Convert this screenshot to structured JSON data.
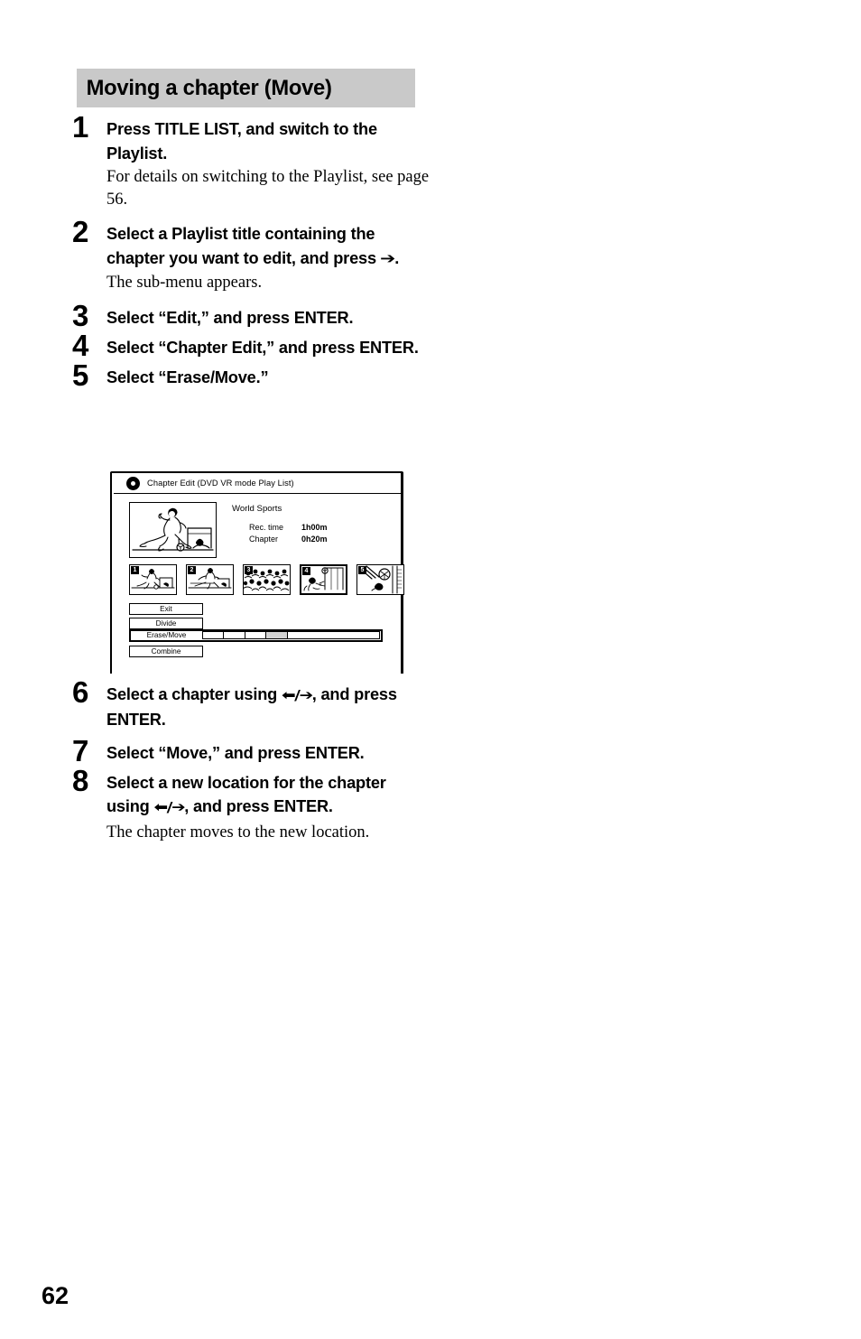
{
  "page": {
    "number": "62"
  },
  "section": {
    "heading": "Moving a chapter (Move)"
  },
  "steps": [
    {
      "number": "1",
      "title": "Press TITLE LIST, and switch to the Playlist.",
      "note": "For details on switching to the Playlist, see page 56."
    },
    {
      "number": "2",
      "title_before_arrow": "Select a Playlist title containing the chapter you want to edit, and press ",
      "arrow": "➔",
      "title_after_arrow": ".",
      "note": "The sub-menu appears."
    },
    {
      "number": "3",
      "title": "Select “Edit,” and press ENTER.",
      "note": ""
    },
    {
      "number": "4",
      "title": "Select “Chapter Edit,” and press ENTER.",
      "note": ""
    },
    {
      "number": "5",
      "title": "Select “Erase/Move.”",
      "note": ""
    },
    {
      "number": "6",
      "title_before_arrow": "Select a chapter using ",
      "arrow": "⬅/➔",
      "title_after_arrow": ", and press ENTER.",
      "note": ""
    },
    {
      "number": "7",
      "title": "Select “Move,” and press ENTER.",
      "note": ""
    },
    {
      "number": "8",
      "title_before_arrow": "Select a new location for the chapter using ",
      "arrow": "⬅/➔",
      "title_after_arrow": ", and press ENTER.",
      "note": "The chapter moves to the new location."
    }
  ],
  "screen": {
    "title_bar": {
      "icon": "disc-icon",
      "text": "Chapter Edit (DVD VR mode Play List)"
    },
    "title": "World Sports",
    "info": [
      {
        "label": "Rec. time",
        "value": "1h00m"
      },
      {
        "label": "Chapter",
        "value": "0h20m"
      }
    ],
    "chapters": [
      {
        "number": "1",
        "selected": false
      },
      {
        "number": "2",
        "selected": false
      },
      {
        "number": "3",
        "selected": false
      },
      {
        "number": "4",
        "selected": true
      },
      {
        "number": "5",
        "selected": false
      }
    ],
    "menu": [
      {
        "label": "Exit",
        "active": false
      },
      {
        "label": "Divide",
        "active": false
      },
      {
        "label": "Erase/Move",
        "active": true
      },
      {
        "label": "Combine",
        "active": false
      }
    ],
    "progress": {
      "segment_widths": [
        12,
        12,
        12,
        12,
        52
      ],
      "filled_index": 3
    }
  },
  "colors": {
    "heading_band": "#c9c9c9",
    "ink": "#000000",
    "progress_fill": "#d2d2d2"
  }
}
